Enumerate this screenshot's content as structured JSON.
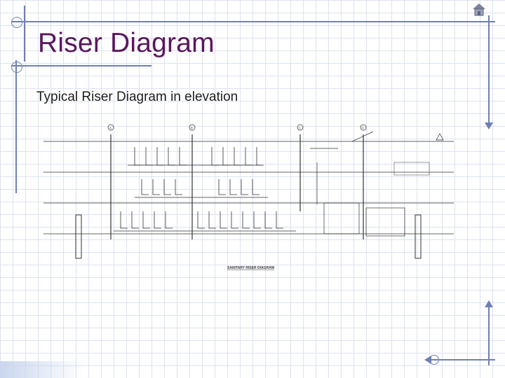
{
  "slide": {
    "title": "Riser Diagram",
    "subtitle": "Typical Riser Diagram in elevation"
  },
  "drawing": {
    "caption": "SANITARY RISER DIAGRAM",
    "tags": [
      "A",
      "B",
      "C",
      "D"
    ]
  },
  "icons": {
    "home": "home-icon"
  },
  "colors": {
    "title": "#5b1660",
    "accent_lines": "#6f7fb3",
    "grid": "#dde3ef"
  }
}
